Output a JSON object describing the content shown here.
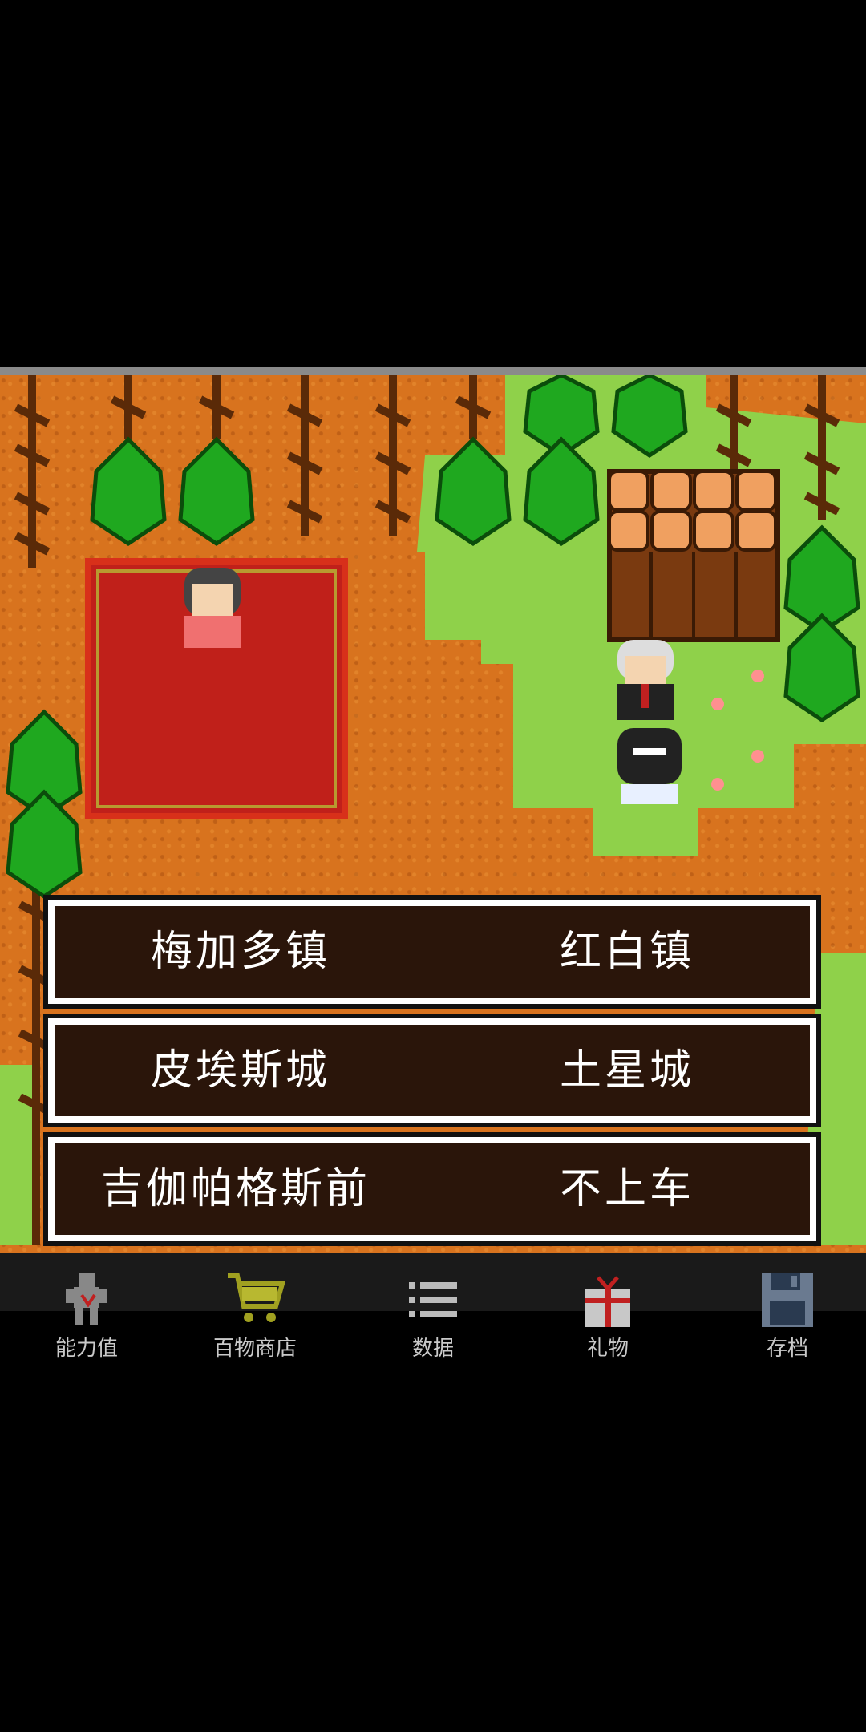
{
  "dialog": {
    "choices": [
      [
        "梅加多镇",
        "红白镇"
      ],
      [
        "皮埃斯城",
        "土星城"
      ],
      [
        "吉伽帕格斯前",
        "不上车"
      ]
    ]
  },
  "bottom_nav": {
    "items": [
      {
        "label": "能力值",
        "icon": "character-stats-icon"
      },
      {
        "label": "百物商店",
        "icon": "shopping-cart-icon"
      },
      {
        "label": "数据",
        "icon": "list-icon"
      },
      {
        "label": "礼物",
        "icon": "gift-icon"
      },
      {
        "label": "存档",
        "icon": "floppy-disk-icon"
      }
    ]
  },
  "colors": {
    "dirt": "#d8731e",
    "grass": "#8fd14a",
    "tree": "#1fa81f",
    "carpet": "#c0201a",
    "dialog_bg": "#2a150a",
    "dialog_border": "#ffffff"
  }
}
